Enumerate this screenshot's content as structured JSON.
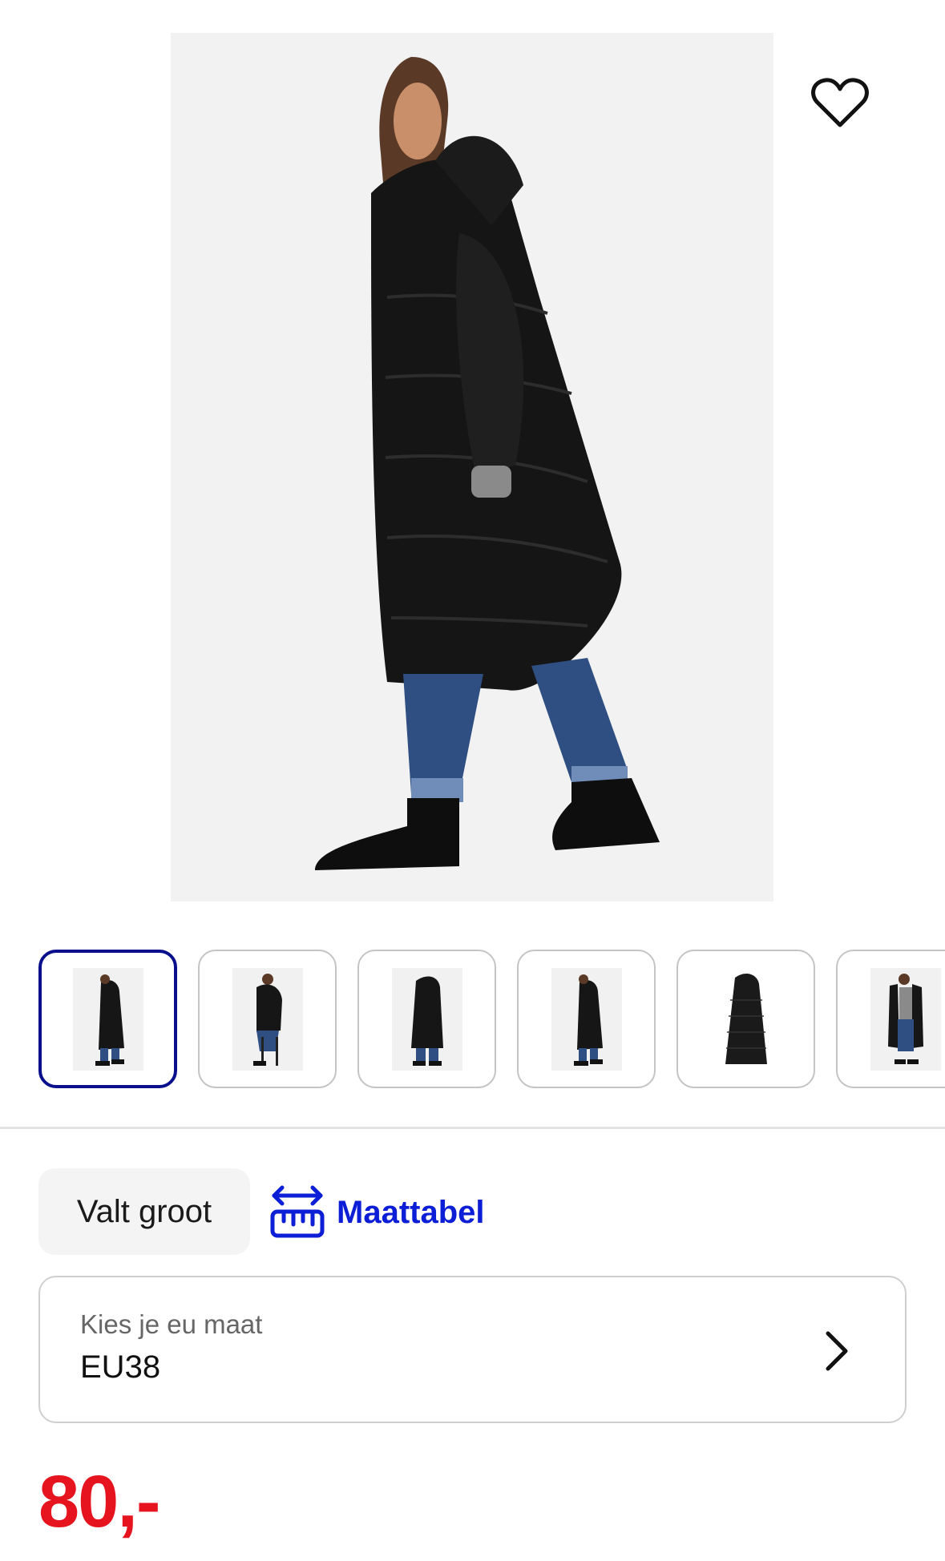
{
  "product": {
    "image_alt": "Lange zwarte pufferjas",
    "thumbnail_count": 6,
    "active_thumbnail": 1
  },
  "fit": {
    "label": "Valt groot"
  },
  "size_chart": {
    "label": "Maattabel",
    "icon": "ruler-icon"
  },
  "size_select": {
    "caption": "Kies je eu maat",
    "value": "EU38",
    "icon": "chevron-right-icon"
  },
  "price": {
    "display": "80,-"
  },
  "colors": {
    "accent_blue": "#0c1ed6",
    "active_border": "#0a0f8c",
    "price_red": "#e6141e",
    "chip_bg": "#f4f4f4"
  }
}
